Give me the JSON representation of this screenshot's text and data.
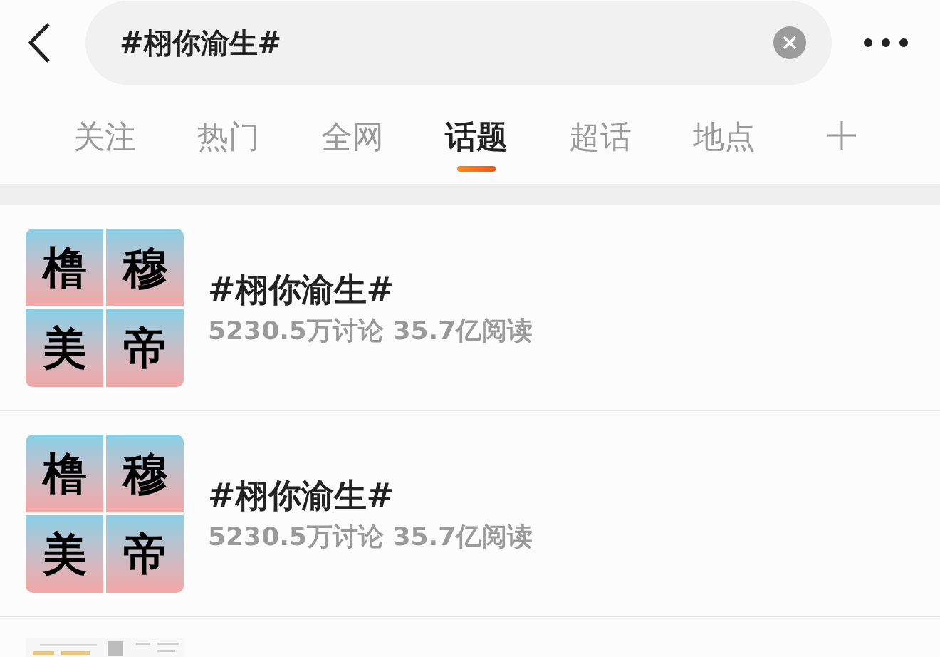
{
  "search": {
    "value": "#栩你渝生#"
  },
  "tabs": [
    {
      "label": "关注",
      "selected": false
    },
    {
      "label": "热门",
      "selected": false
    },
    {
      "label": "全网",
      "selected": false
    },
    {
      "label": "话题",
      "selected": true
    },
    {
      "label": "超话",
      "selected": false
    },
    {
      "label": "地点",
      "selected": false
    }
  ],
  "results": [
    {
      "kind": "topic",
      "tiles": [
        "橹",
        "穆",
        "美",
        "帝"
      ],
      "title": "#栩你渝生#",
      "stats": "5230.5万讨论 35.7亿阅读"
    },
    {
      "kind": "topic",
      "tiles": [
        "橹",
        "穆",
        "美",
        "帝"
      ],
      "title": "#栩你渝生#",
      "stats": "5230.5万讨论 35.7亿阅读"
    },
    {
      "kind": "picture"
    }
  ]
}
